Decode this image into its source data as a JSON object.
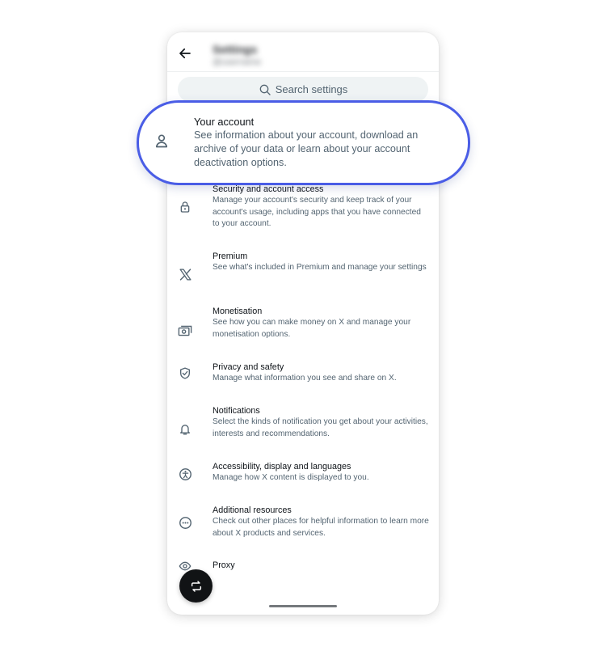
{
  "header": {
    "title": "Settings",
    "subtitle": "@username"
  },
  "search": {
    "placeholder": "Search settings"
  },
  "highlighted": {
    "title": "Your account",
    "description": "See information about your account, download an archive of your data or learn about your account deactivation options.",
    "icon": "person-icon",
    "border_color": "#4a5de6"
  },
  "items": [
    {
      "title": "Security and account access",
      "description": "Manage your account's security and keep track of your account's usage, including apps that you have connected to your account.",
      "icon": "lock-icon"
    },
    {
      "title": "Premium",
      "description": "See what's included in Premium and manage your settings",
      "icon": "x-logo-icon"
    },
    {
      "title": "Monetisation",
      "description": "See how you can make money on X and manage your monetisation options.",
      "icon": "money-icon"
    },
    {
      "title": "Privacy and safety",
      "description": "Manage what information you see and share on X.",
      "icon": "shield-check-icon"
    },
    {
      "title": "Notifications",
      "description": "Select the kinds of notification you get about your activities, interests and recommendations.",
      "icon": "bell-icon"
    },
    {
      "title": "Accessibility, display and languages",
      "description": "Manage how X content is displayed to you.",
      "icon": "accessibility-icon"
    },
    {
      "title": "Additional resources",
      "description": "Check out other places for helpful information to learn more about X products and services.",
      "icon": "more-circle-icon"
    },
    {
      "title": "Proxy",
      "description": "",
      "icon": "eye-icon"
    }
  ],
  "fab": {
    "icon": "repost-icon"
  },
  "colors": {
    "text_primary": "#0f1419",
    "text_secondary": "#536471",
    "search_bg": "#eff3f4",
    "fab_bg": "#111315"
  }
}
